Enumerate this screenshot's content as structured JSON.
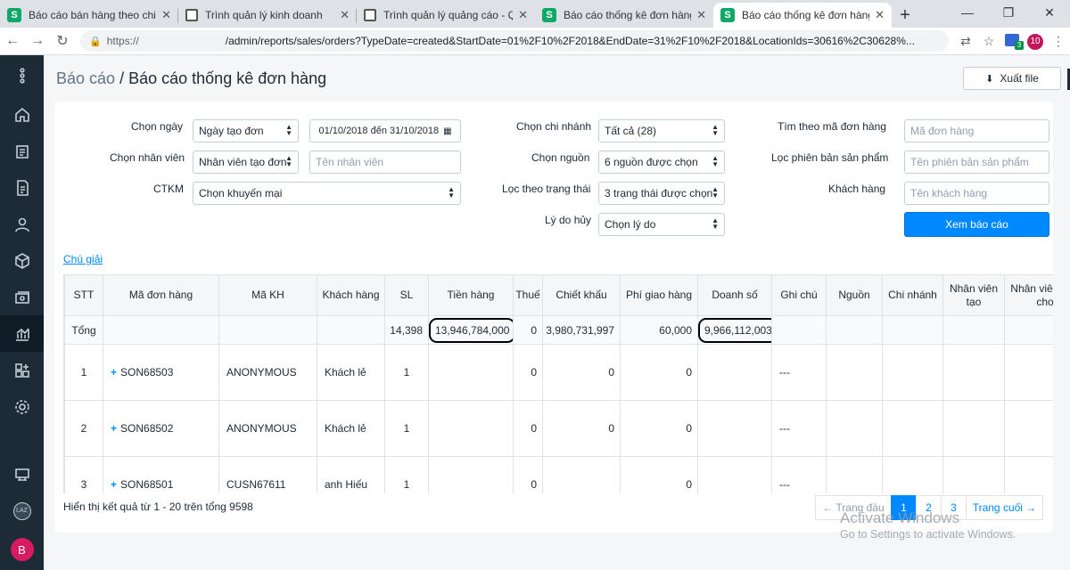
{
  "browser": {
    "tabs": [
      {
        "title": "Báo cáo bán hàng theo chi nhá",
        "icon": "s"
      },
      {
        "title": "Trình quản lý kinh doanh",
        "icon": "doc"
      },
      {
        "title": "Trình quản lý quảng cáo - Quả",
        "icon": "doc"
      },
      {
        "title": "Báo cáo thống kê đơn hàng",
        "icon": "s"
      },
      {
        "title": "Báo cáo thống kê đơn hàng",
        "icon": "s"
      }
    ],
    "url_prefix": "https://",
    "url_rest": "/admin/reports/sales/orders?TypeDate=created&StartDate=01%2F10%2F2018&EndDate=31%2F10%2F2018&LocationIds=30616%2C30628%...",
    "ext_badge": "3",
    "profile_badge": "10"
  },
  "sidebar": {
    "avatar_small": "LAZ",
    "avatar_initial": "B"
  },
  "header": {
    "breadcrumb_parent": "Báo cáo",
    "separator": "/",
    "title": "Báo cáo thống kê đơn hàng",
    "export_label": "Xuất file"
  },
  "filters": {
    "date_type_label": "Chọn ngày",
    "date_type_value": "Ngày tạo đơn",
    "date_range_value": "01/10/2018 đến 31/10/2018",
    "branch_label": "Chọn chi nhánh",
    "branch_value": "Tất cả (28)",
    "order_code_label": "Tìm theo mã đơn hàng",
    "order_code_placeholder": "Mã đơn hàng",
    "staff_label": "Chọn nhân viên",
    "staff_type_value": "Nhân viên tạo đơn",
    "staff_placeholder": "Tên nhân viên",
    "source_label": "Chọn nguồn",
    "source_value": "6 nguồn được chọn",
    "variant_label": "Lọc phiên bản sản phẩm",
    "variant_placeholder": "Tên phiên bản sản phẩm",
    "promo_label": "CTKM",
    "promo_value": "Chọn khuyến mại",
    "status_label": "Lọc theo trạng thái",
    "status_value": "3 trạng thái được chọn",
    "customer_label": "Khách hàng",
    "customer_placeholder": "Tên khách hàng",
    "cancel_label": "Lý do hủy",
    "cancel_value": "Chọn lý do",
    "submit_label": "Xem báo cáo"
  },
  "legend_link": "Chú giải",
  "table": {
    "headers": [
      "STT",
      "Mã đơn hàng",
      "Mã KH",
      "Khách hàng",
      "SL",
      "Tiền hàng",
      "Thuế",
      "Chiết khấu",
      "Phí giao hàng",
      "Doanh số",
      "Ghi chú",
      "Nguồn",
      "Chi nhánh",
      "Nhân viên tạo",
      "Nhân viên gán cho"
    ],
    "total": {
      "label": "Tổng",
      "qty": "14,398",
      "amount": "13,946,784,000",
      "tax": "0",
      "discount": "3,980,731,997",
      "shipping": "60,000",
      "revenue": "9,966,112,003"
    },
    "rows": [
      {
        "stt": "1",
        "order": "SON68503",
        "customer_code": "ANONYMOUS",
        "customer": "Khách lẻ",
        "qty": "1",
        "amount": "",
        "tax": "0",
        "discount": "0",
        "shipping": "0",
        "revenue": "",
        "note": "---"
      },
      {
        "stt": "2",
        "order": "SON68502",
        "customer_code": "ANONYMOUS",
        "customer": "Khách lẻ",
        "qty": "1",
        "amount": "",
        "tax": "0",
        "discount": "0",
        "shipping": "0",
        "revenue": "",
        "note": "---"
      },
      {
        "stt": "3",
        "order": "SON68501",
        "customer_code": "CUSN67611",
        "customer": "anh Hiếu",
        "qty": "1",
        "amount": "",
        "tax": "0",
        "discount": "",
        "shipping": "0",
        "revenue": "",
        "note": "---"
      }
    ]
  },
  "results_text": "Hiển thị kết quả từ 1 - 20 trên tổng 9598",
  "pagination": {
    "first": "← Trang đầu",
    "pages": [
      "1",
      "2",
      "3"
    ],
    "last": "Trang cuối →",
    "current": "1"
  },
  "watermark": {
    "line1": "Activate Windows",
    "line2": "Go to Settings to activate Windows."
  },
  "colors": {
    "accent": "#0088ff",
    "sidebar": "#1c2b36",
    "brand_green": "#0fa868"
  }
}
